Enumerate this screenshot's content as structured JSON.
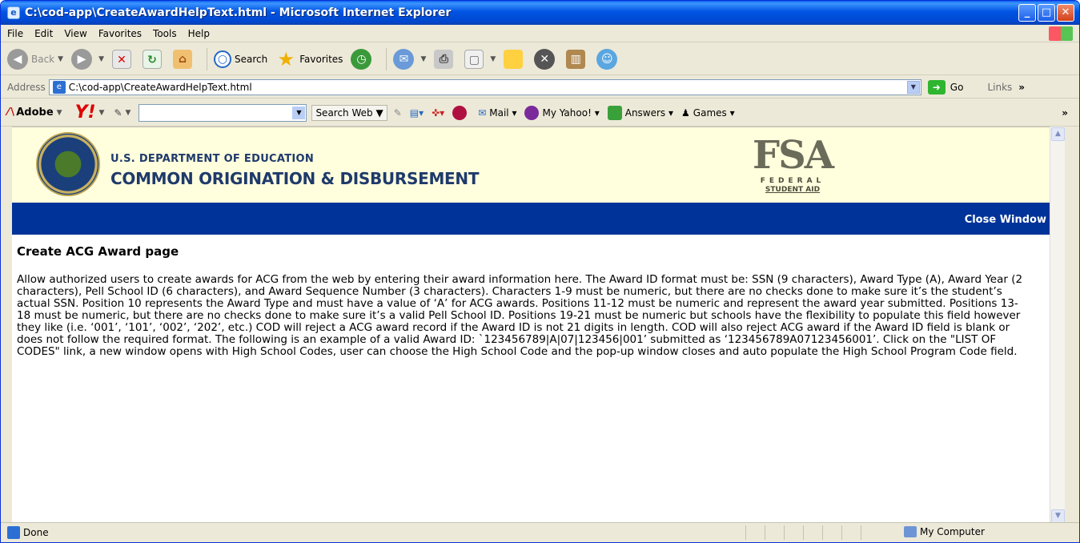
{
  "window": {
    "title": "C:\\cod-app\\CreateAwardHelpText.html - Microsoft Internet Explorer"
  },
  "menu": [
    "File",
    "Edit",
    "View",
    "Favorites",
    "Tools",
    "Help"
  ],
  "toolbar": {
    "back": "Back",
    "search": "Search",
    "favorites": "Favorites"
  },
  "address": {
    "label": "Address",
    "url": "C:\\cod-app\\CreateAwardHelpText.html",
    "go": "Go",
    "links": "Links"
  },
  "ytoolbar": {
    "adobe": "Adobe",
    "yahoo": "Y!",
    "search_web": "Search Web",
    "mail": "Mail",
    "my_yahoo": "My Yahoo!",
    "answers": "Answers",
    "games": "Games"
  },
  "header": {
    "dept": "U.S. DEPARTMENT OF EDUCATION",
    "cod": "COMMON ORIGINATION & DISBURSEMENT",
    "fsa": "FSA",
    "fsa_sub1": "FEDERAL",
    "fsa_sub2": "STUDENT AID"
  },
  "nav": {
    "close": "Close Window"
  },
  "page": {
    "title": "Create ACG Award page",
    "body": "Allow authorized users to create awards for ACG from the web by entering their award information here. The Award ID format must be: SSN (9 characters), Award Type (A), Award Year (2 characters), Pell School ID (6 characters), and Award Sequence Number (3 characters). Characters 1-9 must be numeric, but there are no checks done to make sure it’s the student’s actual SSN. Position 10 represents the Award Type and must have a value of ‘A’ for ACG awards. Positions 11-12 must be numeric and represent the award year submitted. Positions 13-18 must be numeric, but there are no checks done to make sure it’s a valid Pell School ID. Positions 19-21 must be numeric but schools have the flexibility to populate this field however they like (i.e. ‘001’, ‘101’, ‘002’, ‘202’, etc.) COD will reject a ACG award record if the Award ID is not 21 digits in length. COD will also reject ACG award if the Award ID field is blank or does not follow the required format. The following is an example of a valid Award ID: `123456789|A|07|123456|001’ submitted as ‘123456789A07123456001’. Click on the \"LIST OF CODES\" link, a new window opens with High School Codes, user can choose the High School Code and the pop-up window closes and auto populate the High School Program Code field."
  },
  "status": {
    "text": "Done",
    "zone": "My Computer"
  }
}
